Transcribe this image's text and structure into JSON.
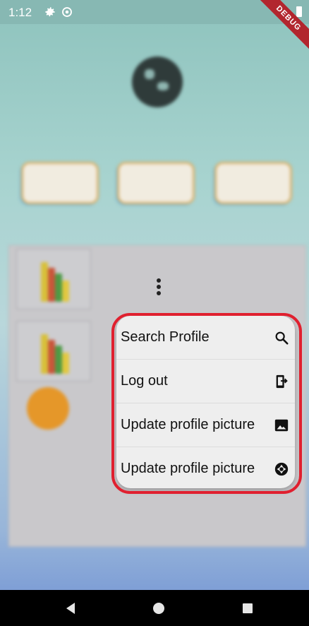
{
  "status_bar": {
    "time": "1:12",
    "debug_label": "DEBUG"
  },
  "profile": {
    "username": ""
  },
  "popup_menu": {
    "items": [
      {
        "label": "Search Profile",
        "icon": "search-icon"
      },
      {
        "label": "Log out",
        "icon": "logout-icon"
      },
      {
        "label": "Update profile picture",
        "icon": "image-icon"
      },
      {
        "label": "Update profile picture",
        "icon": "camera-shutter-icon"
      }
    ]
  },
  "colors": {
    "highlight": "#e0202f",
    "fab": "#e59729",
    "menu_bg": "#eeeeee"
  },
  "nav_bar": {
    "buttons": [
      "back-icon",
      "home-icon",
      "recents-icon"
    ]
  }
}
